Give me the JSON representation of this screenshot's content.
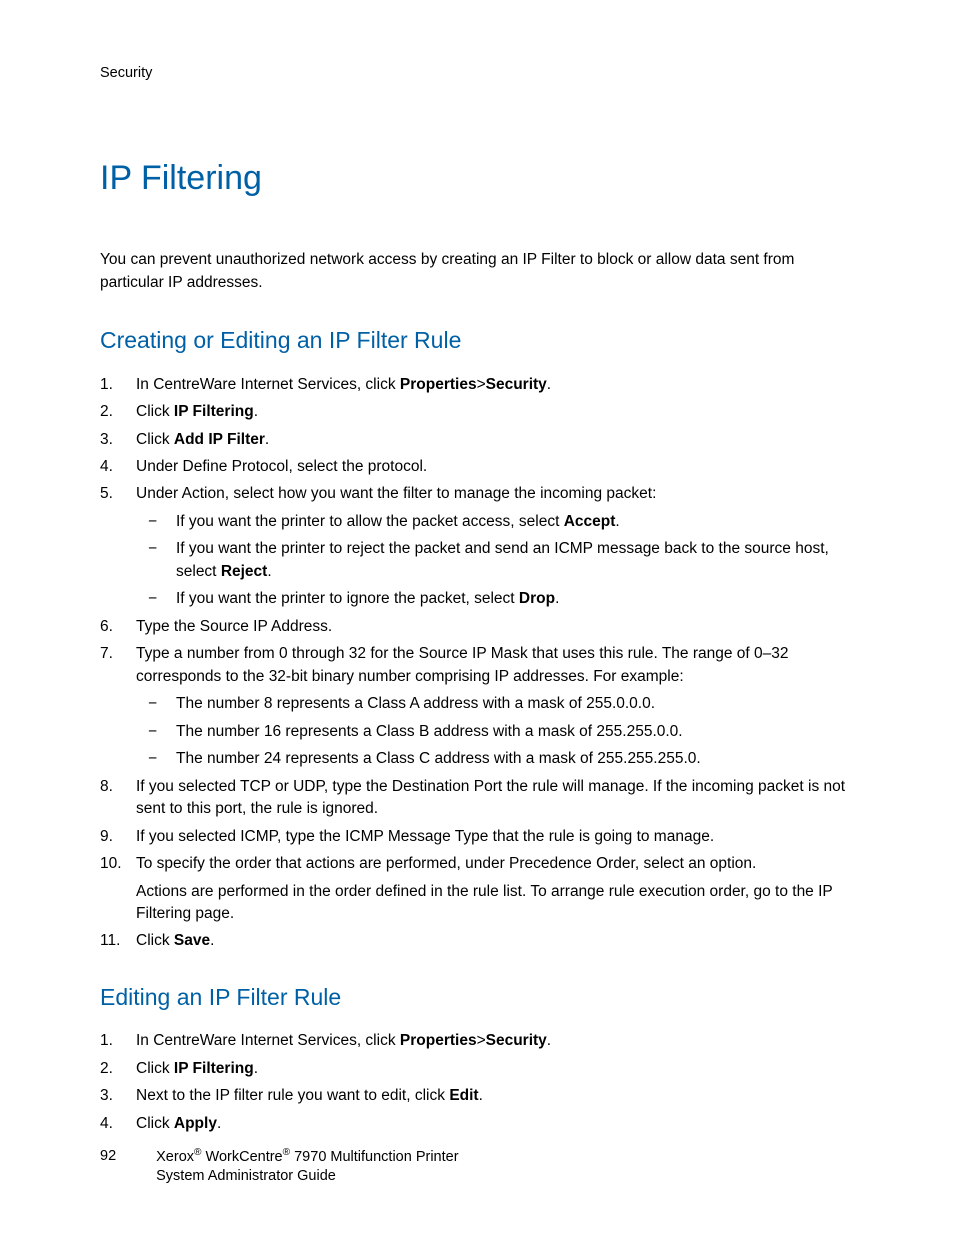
{
  "header": "Security",
  "title": "IP Filtering",
  "intro": "You can prevent unauthorized network access by creating an IP Filter to block or allow data sent from particular IP addresses.",
  "section1": {
    "heading": "Creating or Editing an IP Filter Rule",
    "steps": {
      "s1a": "In CentreWare Internet Services, click ",
      "s1b": "Properties",
      "s1c": ">",
      "s1d": "Security",
      "s1e": ".",
      "s2a": "Click ",
      "s2b": "IP Filtering",
      "s2c": ".",
      "s3a": "Click ",
      "s3b": "Add IP Filter",
      "s3c": ".",
      "s4": "Under Define Protocol, select the protocol.",
      "s5": "Under Action, select how you want the filter to manage the incoming packet:",
      "s5sub1a": "If you want the printer to allow the packet access, select ",
      "s5sub1b": "Accept",
      "s5sub1c": ".",
      "s5sub2a": "If you want the printer to reject the packet and send an ICMP message back to the source host, select ",
      "s5sub2b": "Reject",
      "s5sub2c": ".",
      "s5sub3a": "If you want the printer to ignore the packet, select ",
      "s5sub3b": "Drop",
      "s5sub3c": ".",
      "s6": "Type the Source IP Address.",
      "s7": "Type a number from 0 through 32 for the Source IP Mask that uses this rule. The range of 0–32 corresponds to the 32-bit binary number comprising IP addresses. For example:",
      "s7sub1": "The number 8 represents a Class A address with a mask of 255.0.0.0.",
      "s7sub2": "The number 16 represents a Class B address with a mask of 255.255.0.0.",
      "s7sub3": "The number 24 represents a Class C address with a mask of 255.255.255.0.",
      "s8": "If you selected TCP or UDP, type the Destination Port the rule will manage. If the incoming packet is not sent to this port, the rule is ignored.",
      "s9": "If you selected ICMP, type the ICMP Message Type that the rule is going to manage.",
      "s10": "To specify the order that actions are performed, under Precedence Order, select an option.",
      "s10b": "Actions are performed in the order defined in the rule list. To arrange rule execution order, go to the IP Filtering page.",
      "s11a": "Click ",
      "s11b": "Save",
      "s11c": "."
    }
  },
  "section2": {
    "heading": "Editing an IP Filter Rule",
    "steps": {
      "s1a": "In CentreWare Internet Services, click ",
      "s1b": "Properties",
      "s1c": ">",
      "s1d": "Security",
      "s1e": ".",
      "s2a": "Click ",
      "s2b": "IP Filtering",
      "s2c": ".",
      "s3a": "Next to the IP filter rule you want to edit, click ",
      "s3b": "Edit",
      "s3c": ".",
      "s4a": "Click ",
      "s4b": "Apply",
      "s4c": "."
    }
  },
  "footer": {
    "page": "92",
    "brand1": "Xerox",
    "brand2": " WorkCentre",
    "model": " 7970 Multifunction Printer",
    "line2": "System Administrator Guide"
  }
}
